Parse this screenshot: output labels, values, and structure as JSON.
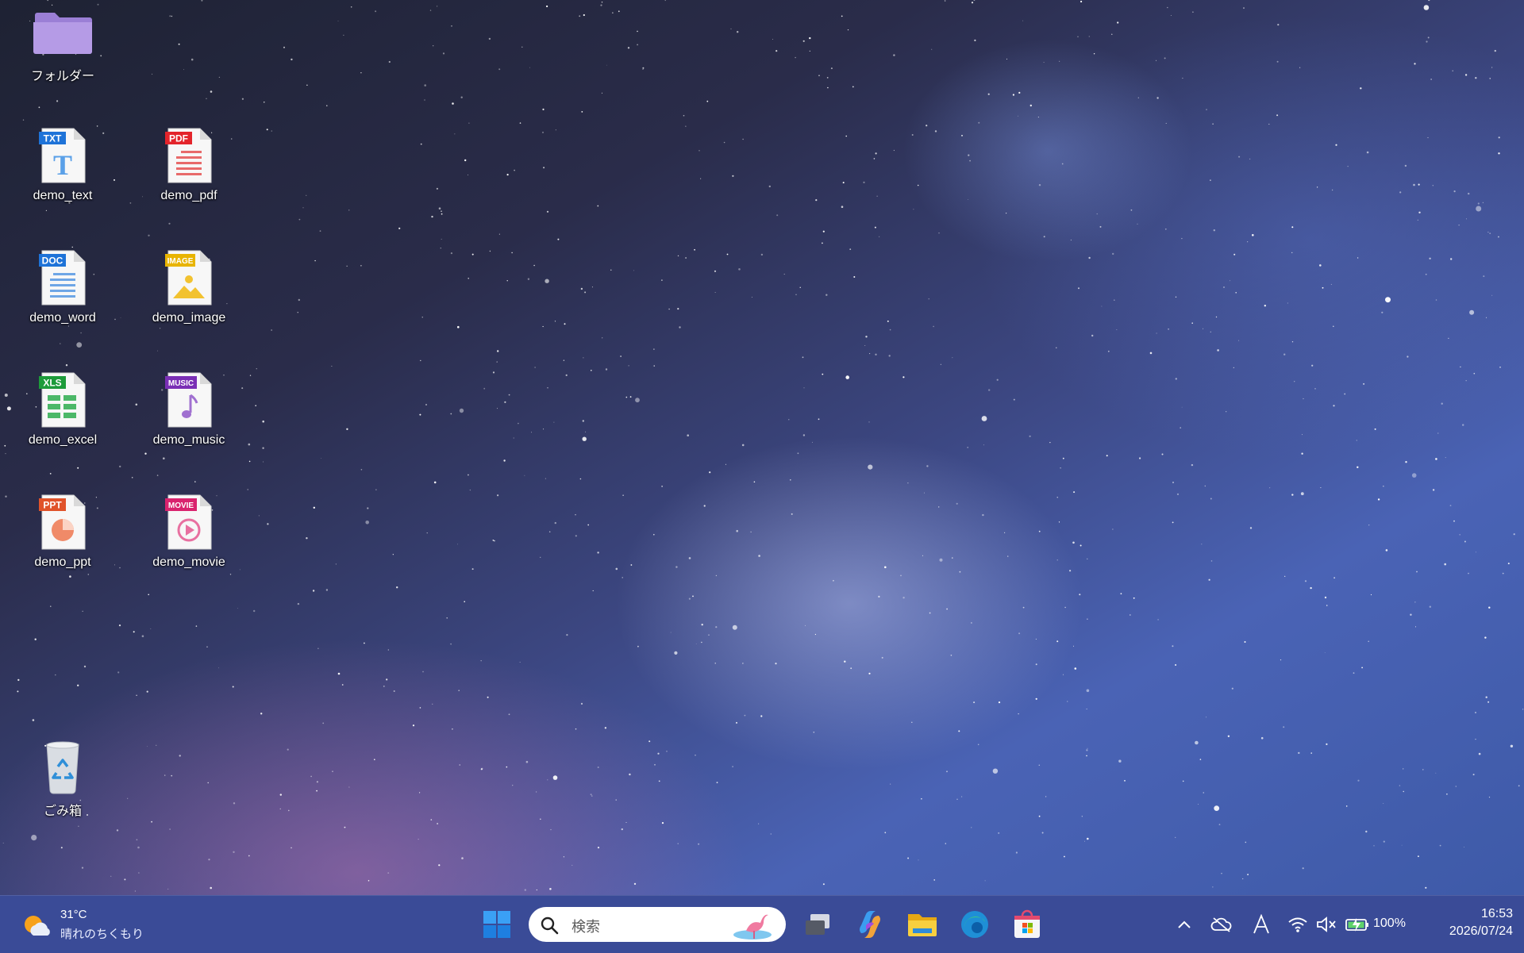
{
  "desktop": {
    "icons": {
      "folder": {
        "label": "フォルダー"
      },
      "demo_text": {
        "label": "demo_text",
        "badge": "TXT"
      },
      "demo_pdf": {
        "label": "demo_pdf",
        "badge": "PDF"
      },
      "demo_word": {
        "label": "demo_word",
        "badge": "DOC"
      },
      "demo_image": {
        "label": "demo_image",
        "badge": "IMAGE"
      },
      "demo_excel": {
        "label": "demo_excel",
        "badge": "XLS"
      },
      "demo_music": {
        "label": "demo_music",
        "badge": "MUSIC"
      },
      "demo_ppt": {
        "label": "demo_ppt",
        "badge": "PPT"
      },
      "demo_movie": {
        "label": "demo_movie",
        "badge": "MOVIE"
      },
      "recycle_bin": {
        "label": "ごみ箱"
      }
    }
  },
  "taskbar": {
    "weather": {
      "temperature": "31°C",
      "condition": "晴れのちくもり",
      "icon": "sun-cloud-icon"
    },
    "search": {
      "placeholder": "検索"
    },
    "pinned": [
      "start-button",
      "task-view-button",
      "copilot-button",
      "file-explorer-button",
      "edge-button",
      "store-button"
    ],
    "tray": {
      "icons": [
        "chevron-up-icon",
        "onedrive-paused-icon",
        "ime-a-icon",
        "wifi-icon",
        "speaker-muted-icon",
        "battery-charging-icon"
      ],
      "battery_percent": "100%"
    },
    "clock": {
      "time": "16:53",
      "date": "2026/07/24"
    }
  },
  "colors": {
    "taskbar": "#3a4b97",
    "accent": "#0078d4"
  }
}
